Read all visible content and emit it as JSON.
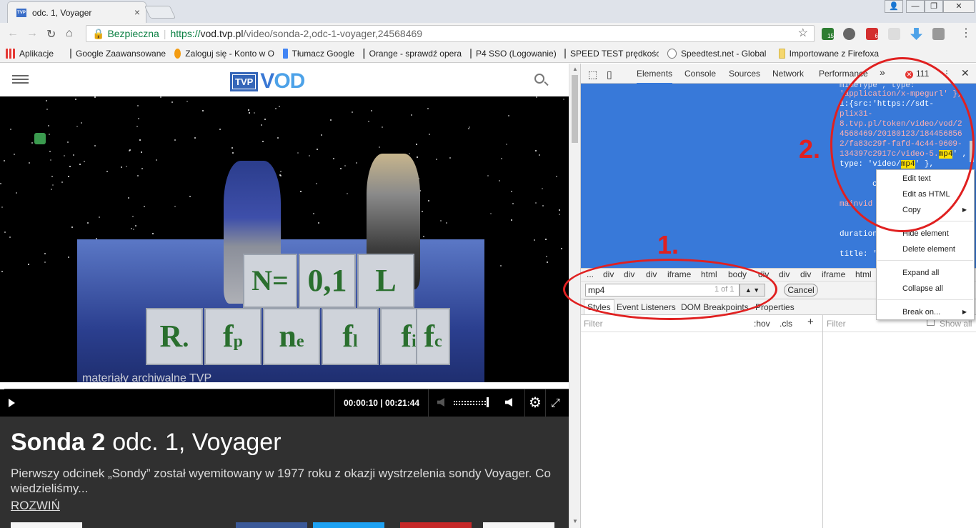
{
  "browser": {
    "tab_title": "odc. 1, Voyager",
    "tab_favicon": "TVP",
    "tab_close": "×",
    "window_controls": [
      "👤",
      "—",
      "❐",
      "✕"
    ],
    "security_label": "Bezpieczna",
    "url_scheme": "https://",
    "url_host": "vod.tvp.pl",
    "url_path": "/video/sonda-2,odc-1-voyager,24568469",
    "extension_badge_count_1": "15",
    "extension_badge_count_2": "6"
  },
  "bookmarks": [
    {
      "label": "Aplikacje"
    },
    {
      "label": "Google Zaawansowane"
    },
    {
      "label": "Zaloguj się - Konto w O"
    },
    {
      "label": "Tłumacz Google"
    },
    {
      "label": "Orange - sprawdź opera"
    },
    {
      "label": "P4 SSO (Logowanie)"
    },
    {
      "label": "SPEED TEST prędkości"
    },
    {
      "label": "Speedtest.net - Global"
    },
    {
      "label": "Importowane z Firefoxa"
    }
  ],
  "site": {
    "logo_tvp": "TVP",
    "logo_vod_a": "V",
    "logo_vod_b": "OD"
  },
  "video": {
    "watermark": "materiały archiwalne TVP",
    "time_current": "00:00:10",
    "time_total": "00:21:44",
    "time_separator": " | ",
    "progress_fraction": 0.008,
    "volume_fraction": 0.95,
    "blocks_top": [
      "N=",
      "0,1",
      "L"
    ],
    "blocks_bottom": [
      "R",
      "f",
      "n",
      "f",
      "f",
      "f"
    ],
    "blocks_bottom_sub": [
      ".",
      "p",
      "e",
      "l",
      "i",
      "c"
    ]
  },
  "program": {
    "series": "Sonda 2",
    "episode": "odc. 1, Voyager",
    "description": "Pierwszy odcinek „Sondy” został wyemitowany w 1977 roku z okazji wystrzelenia sondy Voyager. Co wiedzieliśmy...",
    "expand_label": "ROZWIŃ"
  },
  "devtools": {
    "tabs": [
      "Elements",
      "Console",
      "Sources",
      "Network",
      "Performance"
    ],
    "more_tabs": "»",
    "error_count": "111",
    "code_lines": [
      "mimeType', type:",
      "'application/x-mpegurl' },",
      "1:{src:'https://sdt-",
      "plix31-",
      "8.tvp.pl/token/video/vod/2",
      "4568469/20180123/184456856",
      "2/fa83c29f-fafd-4c44-9609-",
      "134397c2917c/video-5.",
      "type: 'video/",
      "c",
      "mainvid",
      "duration",
      "title: '"
    ],
    "highlight_term": "mp4",
    "breadcrumb": [
      "...",
      "div",
      "div",
      "div",
      "iframe",
      "html",
      "body",
      "div",
      "div",
      "div",
      "iframe",
      "html"
    ],
    "search_value": "mp4",
    "search_count": "1 of 1",
    "search_cancel": "Cancel",
    "subtabs": [
      "Styles",
      "Event Listeners",
      "DOM Breakpoints",
      "Properties"
    ],
    "filter_placeholder": "Filter",
    "hov": ":hov",
    "cls": ".cls",
    "add": "+",
    "filter2_placeholder": "Filter",
    "show_all": "Show all"
  },
  "context_menu": {
    "items": [
      "Edit text",
      "Edit as HTML",
      "Copy",
      "Hide element",
      "Delete element",
      "Expand all",
      "Collapse all",
      "Break on..."
    ]
  },
  "annotations": {
    "label_1": "1.",
    "label_2": "2.",
    "color": "#e02020"
  },
  "colors": {
    "devtools_selection": "#3879d9",
    "info_panel": "#303030",
    "tvp_blue": "#3566b8",
    "secure_green": "#0b8043"
  }
}
